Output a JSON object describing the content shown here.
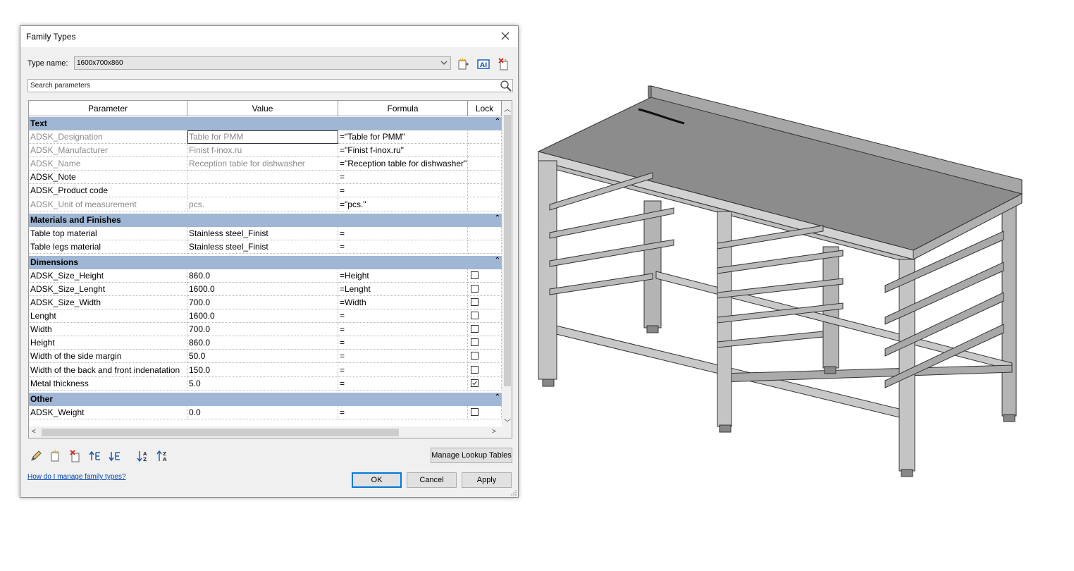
{
  "dialog": {
    "title": "Family Types",
    "type_name_label": "Type name:",
    "type_name_value": "1600x700x860",
    "search_placeholder": "Search parameters"
  },
  "grid": {
    "columns": [
      "Parameter",
      "Value",
      "Formula",
      "Lock"
    ],
    "groups": [
      {
        "name": "Text",
        "rows": [
          {
            "param": "ADSK_Designation",
            "value": "Table for PMM",
            "formula": "=\"Table for PMM\"",
            "lock": null,
            "grey": true,
            "editing": true
          },
          {
            "param": "ADSK_Manufacturer",
            "value": "Finist f-inox.ru",
            "formula": "=\"Finist f-inox.ru\"",
            "lock": null,
            "grey": true
          },
          {
            "param": "ADSK_Name",
            "value": "Reception table for dishwasher",
            "formula": "=\"Reception table for dishwasher\"",
            "lock": null,
            "grey": true
          },
          {
            "param": "ADSK_Note",
            "value": "",
            "formula": "=",
            "lock": null,
            "grey": false
          },
          {
            "param": "ADSK_Product code",
            "value": "",
            "formula": "=",
            "lock": null,
            "grey": false
          },
          {
            "param": "ADSK_Unit of measurement",
            "value": "pcs.",
            "formula": "=\"pcs.\"",
            "lock": null,
            "grey": true
          }
        ]
      },
      {
        "name": "Materials and Finishes",
        "rows": [
          {
            "param": "Table top material",
            "value": "Stainless steel_Finist",
            "formula": "=",
            "lock": null,
            "grey": false
          },
          {
            "param": "Table legs material",
            "value": "Stainless steel_Finist",
            "formula": "=",
            "lock": null,
            "grey": false
          }
        ]
      },
      {
        "name": "Dimensions",
        "rows": [
          {
            "param": "ADSK_Size_Height",
            "value": "860.0",
            "formula": "=Height",
            "lock": false,
            "grey": false
          },
          {
            "param": "ADSK_Size_Lenght",
            "value": "1600.0",
            "formula": "=Lenght",
            "lock": false,
            "grey": false
          },
          {
            "param": "ADSK_Size_Width",
            "value": "700.0",
            "formula": "=Width",
            "lock": false,
            "grey": false
          },
          {
            "param": "Lenght",
            "value": "1600.0",
            "formula": "=",
            "lock": false,
            "grey": false
          },
          {
            "param": "Width",
            "value": "700.0",
            "formula": "=",
            "lock": false,
            "grey": false
          },
          {
            "param": "Height",
            "value": "860.0",
            "formula": "=",
            "lock": false,
            "grey": false
          },
          {
            "param": "Width of the side margin",
            "value": "50.0",
            "formula": "=",
            "lock": false,
            "grey": false
          },
          {
            "param": "Width of the back and front indenatation",
            "value": "150.0",
            "formula": "=",
            "lock": false,
            "grey": false
          },
          {
            "param": "Metal thickness",
            "value": "5.0",
            "formula": "=",
            "lock": true,
            "grey": false
          }
        ]
      },
      {
        "name": "Other",
        "rows": [
          {
            "param": "ADSK_Weight",
            "value": "0.0",
            "formula": "=",
            "lock": false,
            "grey": false
          }
        ]
      }
    ]
  },
  "buttons": {
    "manage_lookup": "Manage Lookup Tables",
    "ok": "OK",
    "cancel": "Cancel",
    "apply": "Apply"
  },
  "help_link": "How do I manage family types?",
  "colors": {
    "group_header": "#9fb7d5",
    "dialog_bg": "#f0f0f0",
    "link": "#0645ad",
    "accent": "#0078d7"
  }
}
